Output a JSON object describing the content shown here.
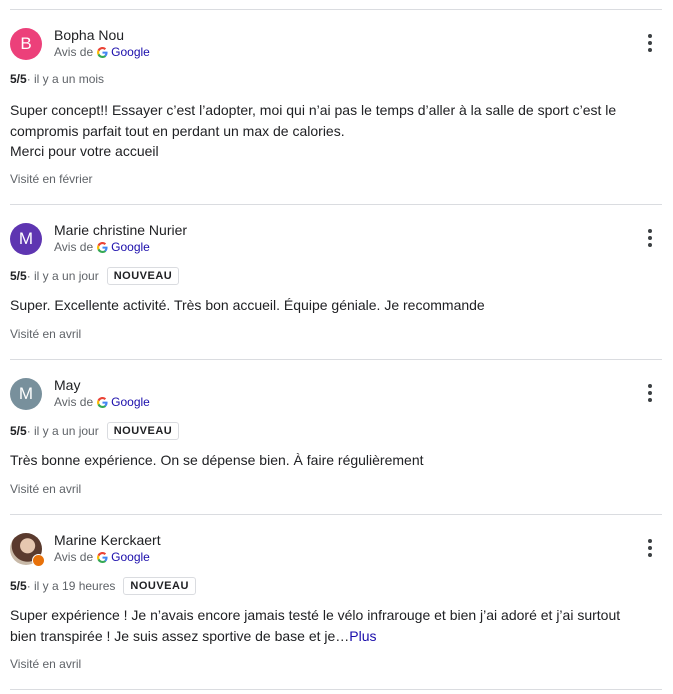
{
  "reviews": [
    {
      "initial": "B",
      "avatar_color": "#ec407a",
      "name": "Bopha Nou",
      "source_prefix": "Avis de",
      "source_name": "Google",
      "rating": "5/5",
      "time": " · il y a un mois",
      "is_new": false,
      "text_lines": [
        "Super concept!! Essayer c’est l’adopter, moi qui n’ai pas le temps d’aller à la salle de sport c’est le compromis parfait tout en perdant un max de calories.",
        "Merci pour votre accueil"
      ],
      "visited": "Visité en février"
    },
    {
      "initial": "M",
      "avatar_color": "#5e35b1",
      "name": "Marie christine Nurier",
      "source_prefix": "Avis de",
      "source_name": "Google",
      "rating": "5/5",
      "time": " · il y a un jour",
      "is_new": true,
      "new_label": "NOUVEAU",
      "text_lines": [
        "Super. Excellente activité. Très bon accueil. Équipe géniale. Je recommande"
      ],
      "visited": "Visité en avril"
    },
    {
      "initial": "M",
      "avatar_color": "#78909c",
      "name": "May",
      "source_prefix": "Avis de",
      "source_name": "Google",
      "rating": "5/5",
      "time": " · il y a un jour",
      "is_new": true,
      "new_label": "NOUVEAU",
      "text_lines": [
        "Très bonne expérience. On se dépense bien. À faire régulièrement"
      ],
      "visited": "Visité en avril"
    },
    {
      "initial": "",
      "avatar_color": "#8d6e63",
      "name": "Marine Kerckaert",
      "source_prefix": "Avis de",
      "source_name": "Google",
      "rating": "5/5",
      "time": " · il y a 19 heures",
      "is_new": true,
      "new_label": "NOUVEAU",
      "text_lines": [
        "Super expérience ! Je n’avais encore jamais testé le vélo infrarouge et bien j’ai adoré et j’ai surtout bien transpirée ! Je suis assez sportive de base et je…"
      ],
      "more_label": "Plus",
      "visited": "Visité en avril"
    }
  ]
}
